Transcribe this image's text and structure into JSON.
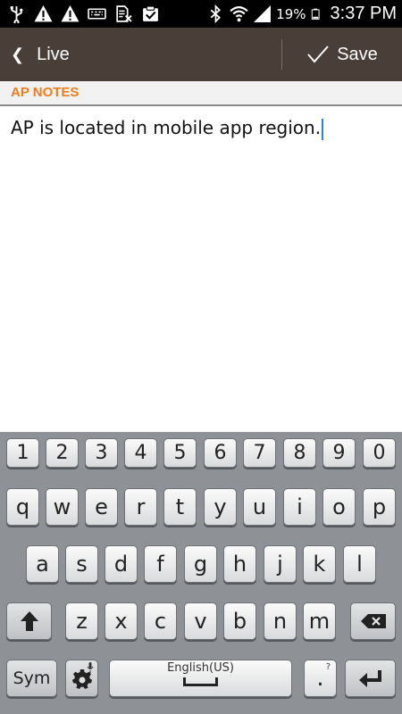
{
  "status_bar": {
    "battery_percent": "19%",
    "time": "3:37 PM",
    "left_icons": [
      "usb-icon",
      "warning-icon",
      "warning-icon",
      "keyboard-icon",
      "sim-off-icon",
      "clipboard-check-icon"
    ],
    "right_icons": [
      "bluetooth-icon",
      "wifi-icon",
      "signal-icon",
      "battery-icon"
    ]
  },
  "action_bar": {
    "back_label": "Live",
    "save_label": "Save",
    "bg_color": "#4a3e39"
  },
  "section": {
    "title": "AP NOTES",
    "title_color": "#f07c1b"
  },
  "note": {
    "text": "AP is located in mobile app region."
  },
  "keyboard": {
    "number_row": [
      "1",
      "2",
      "3",
      "4",
      "5",
      "6",
      "7",
      "8",
      "9",
      "0"
    ],
    "row1": [
      "q",
      "w",
      "e",
      "r",
      "t",
      "y",
      "u",
      "i",
      "o",
      "p"
    ],
    "row2": [
      "a",
      "s",
      "d",
      "f",
      "g",
      "h",
      "j",
      "k",
      "l"
    ],
    "row3": [
      "z",
      "x",
      "c",
      "v",
      "b",
      "n",
      "m"
    ],
    "sym_label": "Sym",
    "space_label": "English(US)",
    "period_label": ".",
    "period_hint": "?"
  }
}
